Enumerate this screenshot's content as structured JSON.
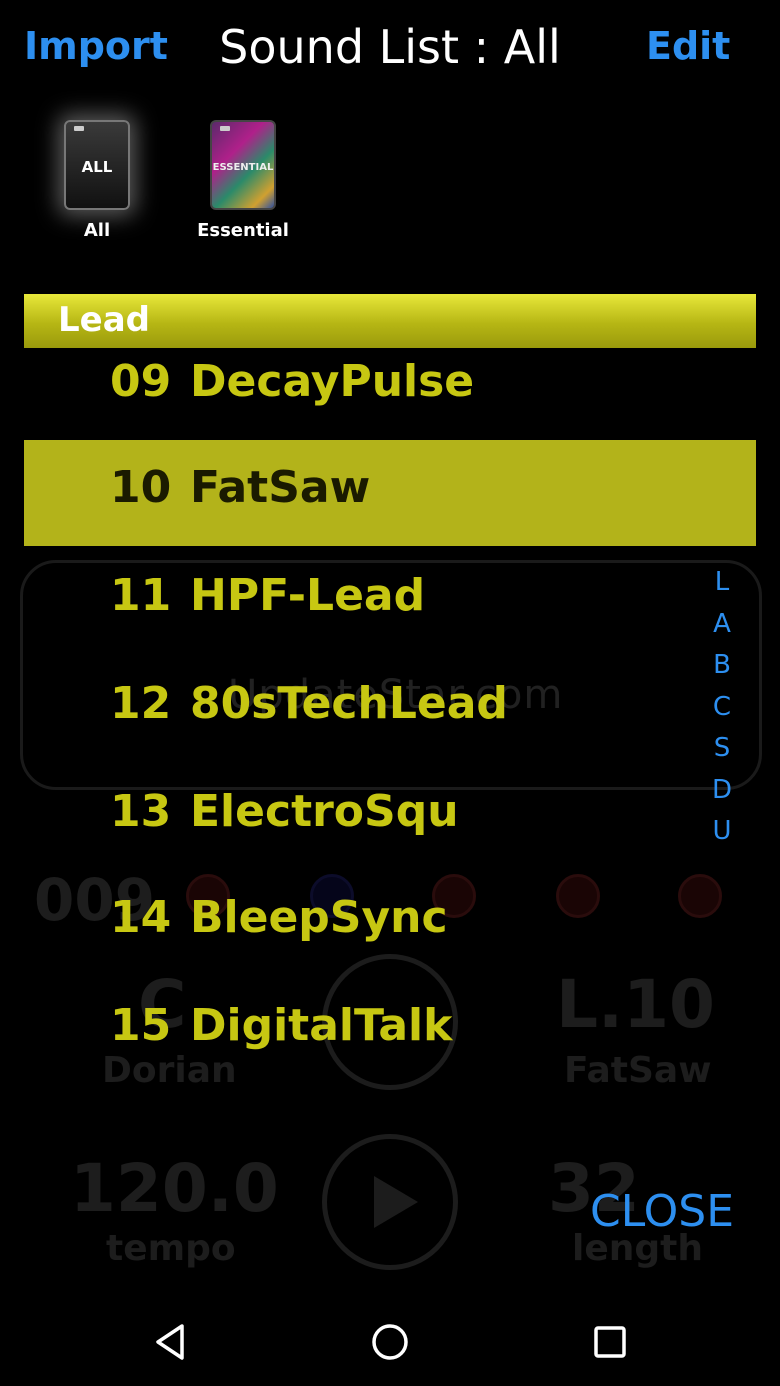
{
  "header": {
    "import_label": "Import",
    "title": "Sound List : All",
    "edit_label": "Edit"
  },
  "categories": [
    {
      "card_text": "ALL",
      "label": "All",
      "selected": true
    },
    {
      "card_text": "ESSENTIAL",
      "label": "Essential",
      "selected": false
    }
  ],
  "list": {
    "group": "Lead",
    "items": [
      {
        "num": "09",
        "name": "DecayPulse",
        "selected": false
      },
      {
        "num": "10",
        "name": "FatSaw",
        "selected": true
      },
      {
        "num": "11",
        "name": "HPF-Lead",
        "selected": false
      },
      {
        "num": "12",
        "name": "80sTechLead",
        "selected": false
      },
      {
        "num": "13",
        "name": "ElectroSqu",
        "selected": false
      },
      {
        "num": "14",
        "name": "BleepSync",
        "selected": false
      },
      {
        "num": "15",
        "name": "DigitalTalk",
        "selected": false
      }
    ]
  },
  "index_letters": [
    "L",
    "A",
    "B",
    "C",
    "S",
    "D",
    "U"
  ],
  "close_label": "CLOSE",
  "watermark": "UpdateStar.com",
  "background": {
    "pattern_num": "009",
    "key": "C",
    "scale": "Dorian",
    "sound_id": "L.10",
    "sound_name": "FatSaw",
    "tempo": "120.0",
    "tempo_label": "tempo",
    "length": "32",
    "length_label": "length"
  },
  "colors": {
    "accent_blue": "#2d8ff0",
    "lead_yellow": "#c7c712",
    "selected_row": "#b3b31a"
  },
  "nav": {
    "back_icon": "back-triangle-icon",
    "home_icon": "home-circle-icon",
    "recent_icon": "recent-square-icon"
  }
}
